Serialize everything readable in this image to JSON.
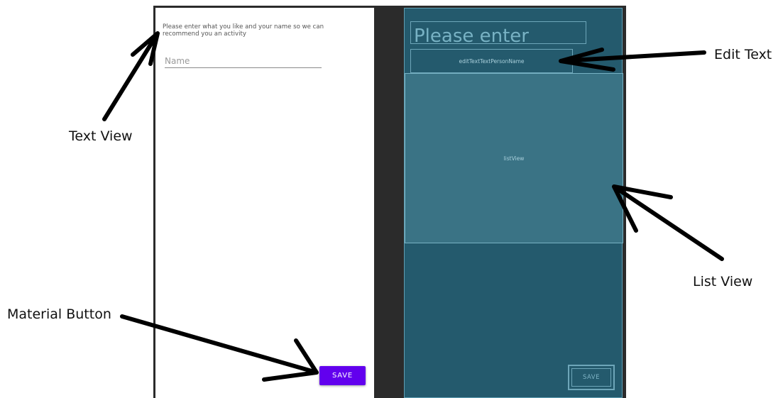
{
  "annotations": {
    "text_view": "Text View",
    "edit_text": "Edit Text",
    "list_view": "List View",
    "material_button": "Material Button"
  },
  "design": {
    "prompt": "Please enter what you like and your name so we can recommend you an activity",
    "name_hint": "Name",
    "save_label": "SAVE",
    "accent_color": "#6200ee"
  },
  "blueprint": {
    "title_preview": "Please enter",
    "edit_text_id": "editTextTextPersonName",
    "list_view_id": "listView",
    "save_label": "SAVE",
    "background_color": "#245a6d"
  }
}
